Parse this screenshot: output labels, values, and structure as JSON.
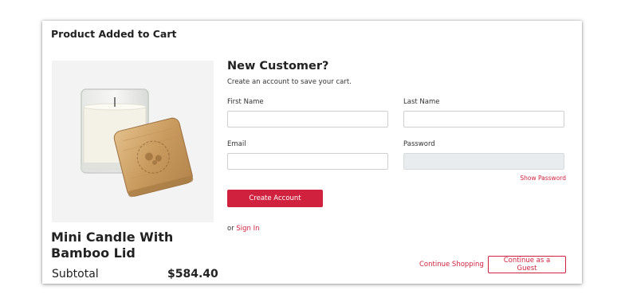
{
  "modal": {
    "title": "Product Added to Cart"
  },
  "product": {
    "name": "Mini Candle With Bamboo Lid",
    "subtotal_label": "Subtotal",
    "subtotal_value": "$584.40",
    "image_icon": "candle-with-bamboo-lid"
  },
  "form": {
    "heading": "New Customer?",
    "subheading": "Create an account to save your cart.",
    "first_name_label": "First Name",
    "first_name_value": "",
    "last_name_label": "Last Name",
    "last_name_value": "",
    "email_label": "Email",
    "email_value": "",
    "password_label": "Password",
    "password_value": "",
    "show_password": "Show Password",
    "create_account": "Create Account",
    "or_text": "or",
    "sign_in": "Sign In"
  },
  "footer": {
    "continue_shopping": "Continue Shopping",
    "continue_guest": "Continue as a Guest"
  },
  "colors": {
    "accent": "#d0223e",
    "text": "#222222",
    "input_border": "#cfcfcf",
    "disabled_input": "#e9ecef"
  }
}
